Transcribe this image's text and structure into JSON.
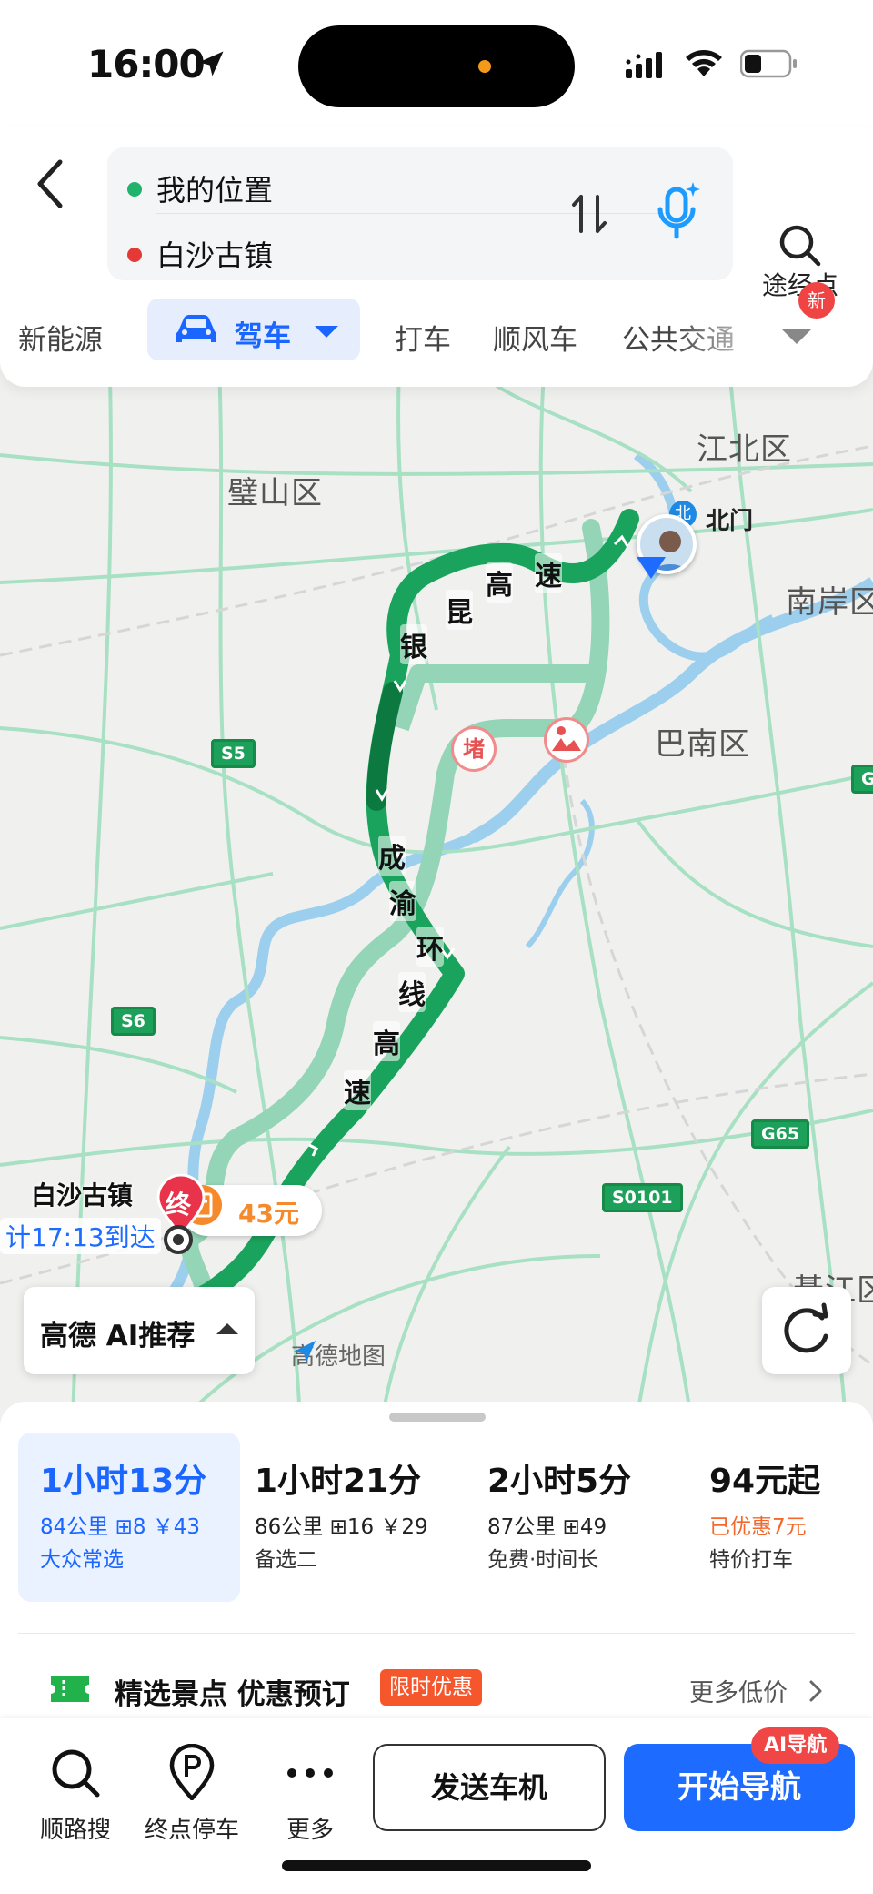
{
  "status_bar": {
    "time": "16:00",
    "icons": [
      "location-arrow-icon",
      "cellular-signal-icon",
      "wifi-icon",
      "battery-icon"
    ]
  },
  "header": {
    "origin": "我的位置",
    "destination": "白沙古镇",
    "waypoint_label": "途经点",
    "icons": [
      "back-chevron-icon",
      "swap-icon",
      "voice-mic-icon",
      "search-icon"
    ]
  },
  "mode_tabs": {
    "items": [
      {
        "label": "新能源",
        "active": false
      },
      {
        "label": "驾车",
        "active": true
      },
      {
        "label": "打车",
        "active": false
      },
      {
        "label": "顺风车",
        "active": false
      },
      {
        "label": "公共交通",
        "active": false
      }
    ],
    "new_badge": "新"
  },
  "map": {
    "districts": [
      "江北区",
      "璧山区",
      "南岸区",
      "巴南区",
      "綦江区"
    ],
    "poi": "北门",
    "poi_icon_glyph": "北",
    "route_road_1": [
      "银",
      "昆",
      "高",
      "速"
    ],
    "route_road_2": [
      "成",
      "渝",
      "环",
      "线",
      "高",
      "速"
    ],
    "highway_shields": [
      "S5",
      "S6",
      "G65",
      "S0101",
      "G"
    ],
    "jam_marker": "堵",
    "toll": "43元",
    "end_pin": "终",
    "destination_label": "白沙古镇",
    "eta": "计17:13到达",
    "ai_recommend": "高德 AI推荐",
    "logo": "高德地图",
    "colors": {
      "main_route": "#1aa35c",
      "alt_route": "#94d4b7",
      "water": "#9ccfee",
      "road": "#9fdcbc"
    }
  },
  "route_options": [
    {
      "time": "1小时13分",
      "meta": "84公里 ⊞8 ￥43",
      "tag": "大众常选",
      "selected": true
    },
    {
      "time": "1小时21分",
      "meta": "86公里 ⊞16 ￥29",
      "tag": "备选二",
      "selected": false
    },
    {
      "time": "2小时5分",
      "meta": "87公里 ⊞49",
      "tag": "免费·时间长",
      "selected": false
    },
    {
      "time": "94元起",
      "meta": "已优惠7元",
      "tag": "特价打车",
      "selected": false
    }
  ],
  "promo": {
    "title": "精选景点 优惠预订",
    "badge": "限时优惠",
    "more": "更多低价"
  },
  "actions": {
    "along_search": "顺路搜",
    "dest_parking": "终点停车",
    "more": "更多",
    "send_car": "发送车机",
    "start_nav": "开始导航",
    "ai_nav_badge": "AI导航"
  }
}
